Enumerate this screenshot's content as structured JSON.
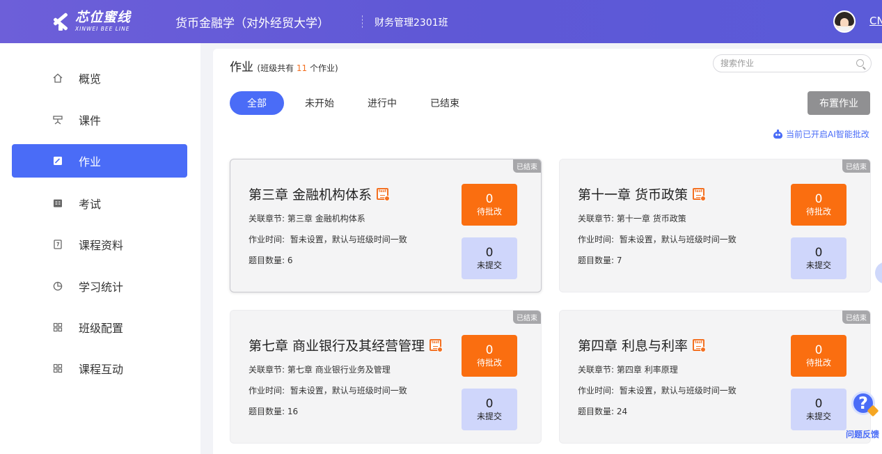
{
  "header": {
    "logo_cn": "芯位蜜线",
    "logo_en": "XINWEI BEE LINE",
    "course_title": "货币金融学（对外经贸大学）",
    "class_name": "财务管理2301班",
    "lang": "CN"
  },
  "sidebar": {
    "items": [
      {
        "label": "概览",
        "icon": "home-icon"
      },
      {
        "label": "课件",
        "icon": "courseware-icon"
      },
      {
        "label": "作业",
        "icon": "homework-icon"
      },
      {
        "label": "考试",
        "icon": "exam-icon"
      },
      {
        "label": "课程资料",
        "icon": "materials-icon"
      },
      {
        "label": "学习统计",
        "icon": "pie-chart-icon"
      },
      {
        "label": "班级配置",
        "icon": "grid-icon"
      },
      {
        "label": "课程互动",
        "icon": "grid-icon"
      }
    ],
    "active_index": 2
  },
  "main": {
    "title": "作业",
    "subtitle_prefix": "(班级共有 ",
    "subtitle_count": "11",
    "subtitle_suffix": " 个作业)",
    "search_placeholder": "搜索作业",
    "tabs": [
      "全部",
      "未开始",
      "进行中",
      "已结束"
    ],
    "active_tab": 0,
    "assign_button": "布置作业",
    "ai_note": "当前已开启AI智能批改",
    "accent_color": "#4a6cf7",
    "pending_color": "#fa6e10"
  },
  "cards": [
    {
      "title": "第三章 金融机构体系",
      "tag": "已结束",
      "chapter_label": "关联章节:",
      "chapter": "第三章 金融机构体系",
      "time_label": "作业时间:",
      "time": "暂未设置，默认与班级时间一致",
      "count_label": "题目数量:",
      "count": "6",
      "pending_num": "0",
      "pending_label": "待批改",
      "unsub_num": "0",
      "unsub_label": "未提交"
    },
    {
      "title": "第十一章 货币政策",
      "tag": "已结束",
      "chapter_label": "关联章节:",
      "chapter": "第十一章 货币政策",
      "time_label": "作业时间:",
      "time": "暂未设置，默认与班级时间一致",
      "count_label": "题目数量:",
      "count": "7",
      "pending_num": "0",
      "pending_label": "待批改",
      "unsub_num": "0",
      "unsub_label": "未提交"
    },
    {
      "title": "第七章 商业银行及其经营管理",
      "tag": "已结束",
      "chapter_label": "关联章节:",
      "chapter": "第七章 商业银行业务及管理",
      "time_label": "作业时间:",
      "time": "暂未设置，默认与班级时间一致",
      "count_label": "题目数量:",
      "count": "16",
      "pending_num": "0",
      "pending_label": "待批改",
      "unsub_num": "0",
      "unsub_label": "未提交"
    },
    {
      "title": "第四章 利息与利率",
      "tag": "已结束",
      "chapter_label": "关联章节:",
      "chapter": "第四章 利率原理",
      "time_label": "作业时间:",
      "time": "暂未设置，默认与班级时间一致",
      "count_label": "题目数量:",
      "count": "24",
      "pending_num": "0",
      "pending_label": "待批改",
      "unsub_num": "0",
      "unsub_label": "未提交"
    }
  ],
  "feedback": {
    "label": "问题反馈"
  }
}
